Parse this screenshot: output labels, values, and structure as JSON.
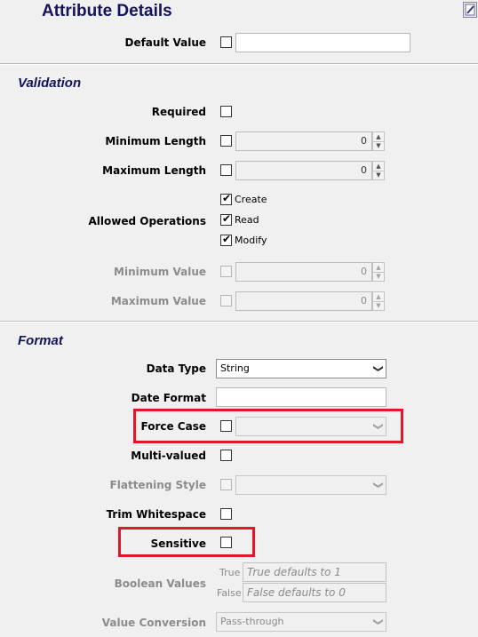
{
  "header": {
    "title": "Attribute Details"
  },
  "default_value": {
    "label": "Default Value",
    "checked": false,
    "value": ""
  },
  "validation": {
    "heading": "Validation",
    "required": {
      "label": "Required",
      "checked": false
    },
    "min_length": {
      "label": "Minimum Length",
      "checked": false,
      "value": "0"
    },
    "max_length": {
      "label": "Maximum Length",
      "checked": false,
      "value": "0"
    },
    "allowed_operations": {
      "label": "Allowed Operations",
      "options": [
        {
          "label": "Create",
          "checked": true
        },
        {
          "label": "Read",
          "checked": true
        },
        {
          "label": "Modify",
          "checked": true
        }
      ]
    },
    "min_value": {
      "label": "Minimum Value",
      "checked": false,
      "value": "0",
      "disabled": true
    },
    "max_value": {
      "label": "Maximum Value",
      "checked": false,
      "value": "0",
      "disabled": true
    }
  },
  "format": {
    "heading": "Format",
    "data_type": {
      "label": "Data Type",
      "value": "String"
    },
    "date_format": {
      "label": "Date Format",
      "value": ""
    },
    "force_case": {
      "label": "Force Case",
      "checked": false,
      "value": ""
    },
    "multi_valued": {
      "label": "Multi-valued",
      "checked": false
    },
    "flattening_style": {
      "label": "Flattening Style",
      "checked": false,
      "value": "",
      "disabled": true
    },
    "trim_whitespace": {
      "label": "Trim Whitespace",
      "checked": false
    },
    "sensitive": {
      "label": "Sensitive",
      "checked": false
    },
    "boolean_values": {
      "label": "Boolean Values",
      "true_label": "True",
      "true_placeholder": "True defaults to 1",
      "false_label": "False",
      "false_placeholder": "False defaults to 0"
    },
    "value_conversion": {
      "label": "Value Conversion",
      "value": "Pass-through"
    }
  },
  "colors": {
    "highlight": "#e0182a",
    "heading": "#14145a",
    "background": "#f0f0f0"
  },
  "icons": {
    "corner": "edit-icon",
    "check": "checkmark-icon",
    "dropdown": "chevron-down-icon"
  }
}
